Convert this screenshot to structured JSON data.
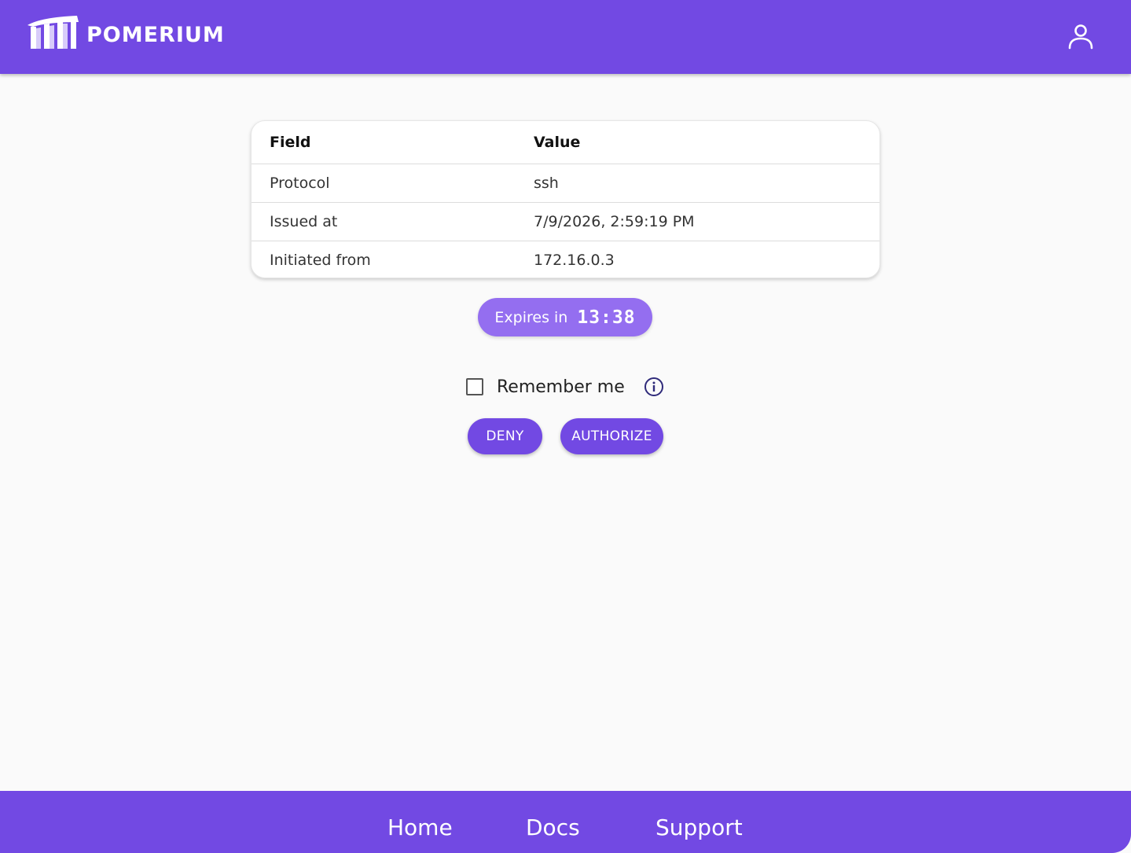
{
  "header": {
    "brand": "POMERIUM",
    "icons": {
      "logo": "pomerium-logo-icon",
      "user": "user-icon"
    }
  },
  "colors": {
    "brand": "#7249e3",
    "badge": "#946ef0",
    "background": "#fafafa"
  },
  "session_table": {
    "headers": [
      "Field",
      "Value"
    ],
    "rows": [
      [
        "Protocol",
        "ssh"
      ],
      [
        "Issued at",
        "7/9/2026, 2:59:19 PM"
      ],
      [
        "Initiated from",
        "172.16.0.3"
      ]
    ]
  },
  "expiry": {
    "label": "Expires in",
    "time": "13:38"
  },
  "remember": {
    "label": "Remember me",
    "checked": false,
    "info_icon": "info-icon"
  },
  "actions": {
    "deny": "DENY",
    "authorize": "AUTHORIZE"
  },
  "footer": {
    "links": [
      "Home",
      "Docs",
      "Support"
    ]
  }
}
